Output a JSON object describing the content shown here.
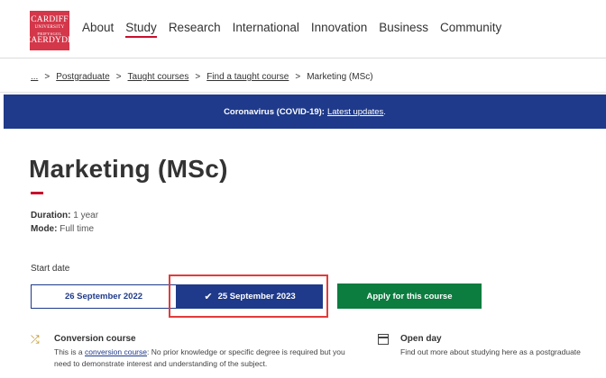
{
  "logo": {
    "line1": "CARDIFF",
    "line2": "UNIVERSITY",
    "line3": "PRIFYSGOL",
    "line4": "CAERDYDD"
  },
  "nav": {
    "items": [
      {
        "label": "About",
        "active": false
      },
      {
        "label": "Study",
        "active": true
      },
      {
        "label": "Research",
        "active": false
      },
      {
        "label": "International",
        "active": false
      },
      {
        "label": "Innovation",
        "active": false
      },
      {
        "label": "Business",
        "active": false
      },
      {
        "label": "Community",
        "active": false
      }
    ]
  },
  "breadcrumb": {
    "ellipsis": "...",
    "items": [
      "Postgraduate",
      "Taught courses",
      "Find a taught course"
    ],
    "current": "Marketing (MSc)",
    "separator": ">"
  },
  "banner": {
    "label": "Coronavirus (COVID-19):",
    "link": "Latest updates",
    "suffix": ".",
    "color": "#1f3a8a"
  },
  "page": {
    "title": "Marketing (MSc)"
  },
  "details": {
    "duration_label": "Duration:",
    "duration_value": "1 year",
    "mode_label": "Mode:",
    "mode_value": "Full time"
  },
  "start_date": {
    "label": "Start date",
    "options": [
      {
        "label": "26 September 2022",
        "selected": false
      },
      {
        "label": "25 September 2023",
        "selected": true
      }
    ]
  },
  "apply": {
    "label": "Apply for this course",
    "color": "#0c7c3f"
  },
  "info": {
    "conversion": {
      "icon": "shuffle-icon",
      "title": "Conversion course",
      "text_before": "This is a ",
      "link": "conversion course",
      "text_after": ": No prior knowledge or specific degree is required but you",
      "line2": "need to demonstrate interest and understanding of the subject."
    },
    "open_day": {
      "icon": "calendar-icon",
      "title": "Open day",
      "text": "Find out more about studying here as a postgraduate"
    }
  }
}
